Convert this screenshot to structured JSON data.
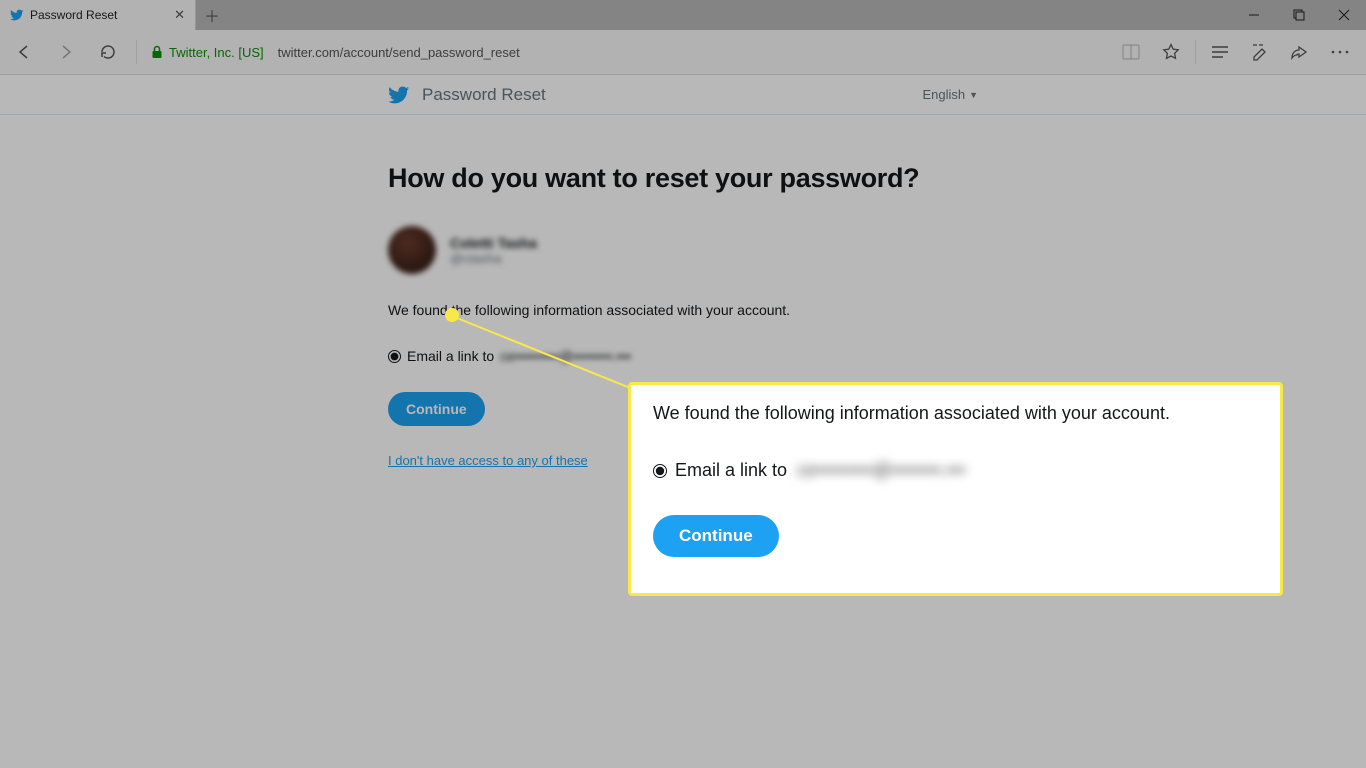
{
  "browser": {
    "tab_title": "Password Reset",
    "cert_label": "Twitter, Inc. [US]",
    "url": "twitter.com/account/send_password_reset"
  },
  "header": {
    "title": "Password Reset",
    "language": "English"
  },
  "main": {
    "heading": "How do you want to reset your password?",
    "user_name": "Coletti Tasha",
    "user_handle": "@ctasha",
    "found_text": "We found the following information associated with your account.",
    "email_option_prefix": "Email a link to ",
    "email_masked": "ce•••••••••@••••••••.•••",
    "continue": "Continue",
    "no_access": "I don't have access to any of these"
  },
  "callout": {
    "text": "We found the following information associated with your account.",
    "email_option_prefix": "Email a link to ",
    "email_masked": "ce•••••••••@••••••••.•••",
    "continue": "Continue"
  }
}
